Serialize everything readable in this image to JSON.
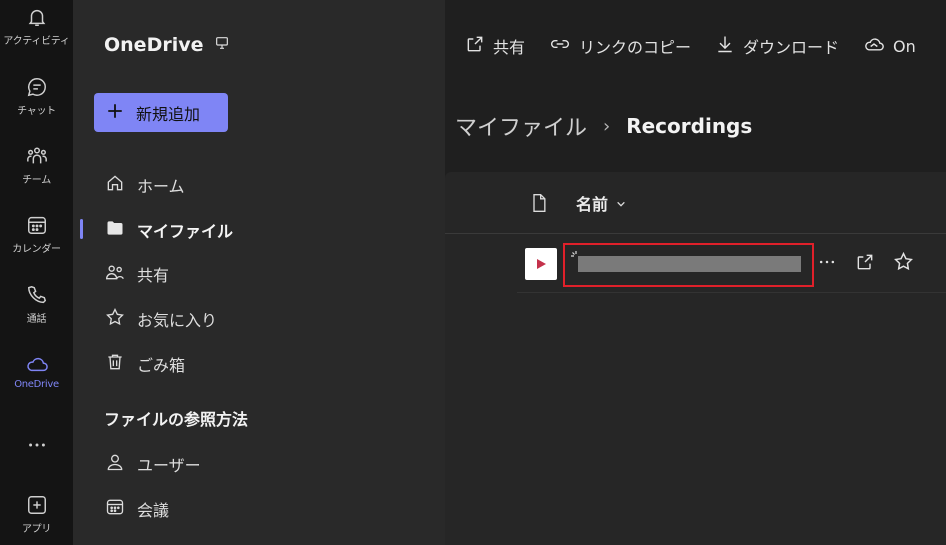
{
  "rail": {
    "items": [
      {
        "label": "アクティビティ",
        "icon": "bell-icon"
      },
      {
        "label": "チャット",
        "icon": "chat-icon"
      },
      {
        "label": "チーム",
        "icon": "teams-icon"
      },
      {
        "label": "カレンダー",
        "icon": "calendar-icon"
      },
      {
        "label": "通話",
        "icon": "phone-icon"
      },
      {
        "label": "OneDrive",
        "icon": "cloud-icon",
        "active": true
      },
      {
        "label": "",
        "icon": "more-icon"
      },
      {
        "label": "アプリ",
        "icon": "add-app-icon"
      }
    ]
  },
  "nav": {
    "title": "OneDrive",
    "new_button": "新規追加",
    "items": [
      {
        "label": "ホーム",
        "icon": "home-icon"
      },
      {
        "label": "マイファイル",
        "icon": "folder-icon",
        "active": true
      },
      {
        "label": "共有",
        "icon": "people-icon"
      },
      {
        "label": "お気に入り",
        "icon": "star-icon"
      },
      {
        "label": "ごみ箱",
        "icon": "trash-icon"
      }
    ],
    "section_title": "ファイルの参照方法",
    "section_items": [
      {
        "label": "ユーザー",
        "icon": "person-icon"
      },
      {
        "label": "会議",
        "icon": "meeting-icon"
      }
    ]
  },
  "toolbar": {
    "share": "共有",
    "copy_link": "リンクのコピー",
    "download": "ダウンロード",
    "more": "On"
  },
  "breadcrumb": {
    "root": "マイファイル",
    "separator": "›",
    "current": "Recordings"
  },
  "list": {
    "column_name": "名前",
    "rows": [
      {
        "type": "video",
        "name_redacted": true
      }
    ]
  },
  "colors": {
    "accent": "#7f85f5",
    "highlight_border": "#e0202a",
    "video_icon": "#c4314b"
  }
}
